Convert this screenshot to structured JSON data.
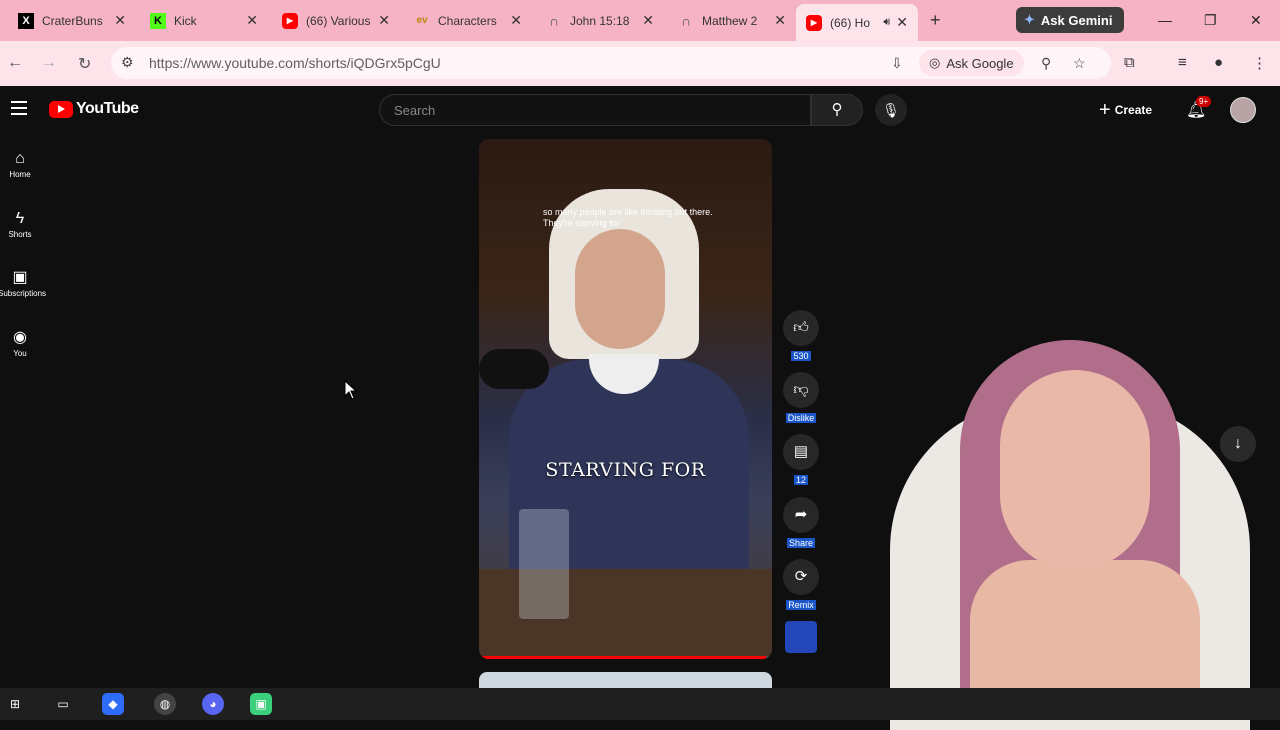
{
  "browser": {
    "tabs": [
      {
        "title": "CraterBuns",
        "favicon": "X"
      },
      {
        "title": "Kick",
        "favicon": "K"
      },
      {
        "title": "(66) Various",
        "favicon": "youtube-icon"
      },
      {
        "title": "Characters",
        "favicon": "ev"
      },
      {
        "title": "John 15:18",
        "favicon": "headset-icon"
      },
      {
        "title": "Matthew 2",
        "favicon": "headset-icon"
      },
      {
        "title": "(66) Ho",
        "favicon": "youtube-icon"
      }
    ],
    "new_tab_label": "+",
    "gemini_label": "Ask Gemini",
    "url": "https://www.youtube.com/shorts/iQDGrx5pCgU",
    "ask_google_label": "Ask Google"
  },
  "youtube": {
    "logo_text": "YouTube",
    "search_placeholder": "Search",
    "create_label": "Create",
    "notification_badge": "9+",
    "sidebar": [
      {
        "label": "Home",
        "icon": "home-icon"
      },
      {
        "label": "Shorts",
        "icon": "shorts-icon"
      },
      {
        "label": "Subscriptions",
        "icon": "subscriptions-icon"
      },
      {
        "label": "You",
        "icon": "you-icon"
      }
    ],
    "short": {
      "subtitle_text": "so many people are like thirsting out there. They're starving for",
      "caption_text": "STARVING FOR",
      "progress": 0.98
    },
    "actions": {
      "like_count": "530",
      "dislike_label": "Dislike",
      "comment_count": "12",
      "share_label": "Share",
      "remix_label": "Remix"
    }
  },
  "colors": {
    "tabbar": "#f6b3c6",
    "toolbar": "#fde3ea",
    "youtube_red": "#ff0000",
    "background": "#0f0f0f"
  }
}
